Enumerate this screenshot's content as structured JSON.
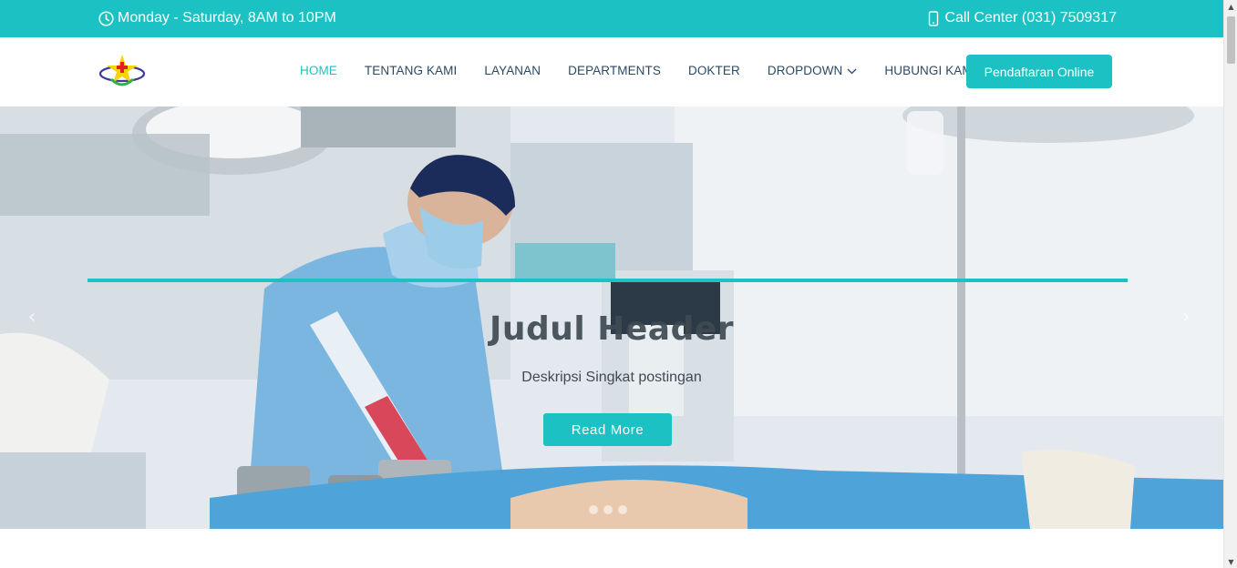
{
  "topbar": {
    "hours_text": "Monday - Saturday, 8AM to 10PM",
    "call_text": "Call Center (031) 7509317",
    "background": "#1cc2c3"
  },
  "header": {
    "logo_alt": "hospital-logo",
    "nav": [
      {
        "label": "HOME",
        "active": true
      },
      {
        "label": "TENTANG KAMI"
      },
      {
        "label": "LAYANAN"
      },
      {
        "label": "DEPARTMENTS"
      },
      {
        "label": "DOKTER"
      },
      {
        "label": "DROPDOWN",
        "has_chevron": true
      },
      {
        "label": "HUBUNGI KAMI"
      }
    ],
    "cta_label": "Pendaftaran Online"
  },
  "hero": {
    "title": "Judul Header",
    "description": "Deskripsi Singkat postingan",
    "button_label": "Read More",
    "accent": "#1cc2c3",
    "image_subject": "surgeon-in-operating-room"
  },
  "colors": {
    "accent": "#1cc2c3",
    "nav_text": "#2c4964"
  }
}
